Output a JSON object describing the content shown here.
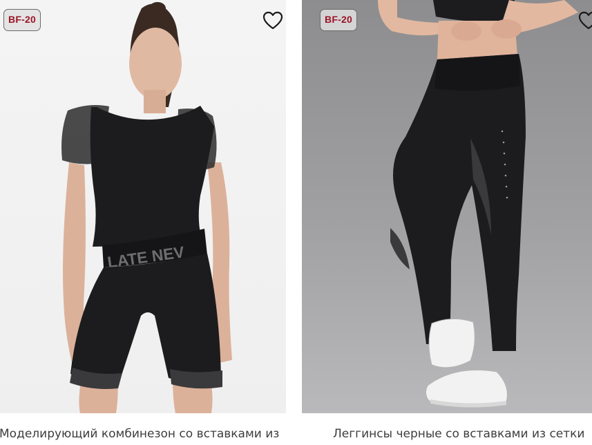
{
  "products": [
    {
      "badge": "BF-20",
      "name": "Моделирующий комбинезон со вставками из",
      "belt_print": "LATE NEV",
      "favorite_icon": "heart-outline-icon"
    },
    {
      "badge": "BF-20",
      "name": "Леггинсы черные со вставками из сетки",
      "favorite_icon": "heart-outline-icon"
    }
  ],
  "colors": {
    "badge_text": "#9b1426",
    "product_name": "#3d3d3d",
    "garment": "#1c1c1e"
  }
}
